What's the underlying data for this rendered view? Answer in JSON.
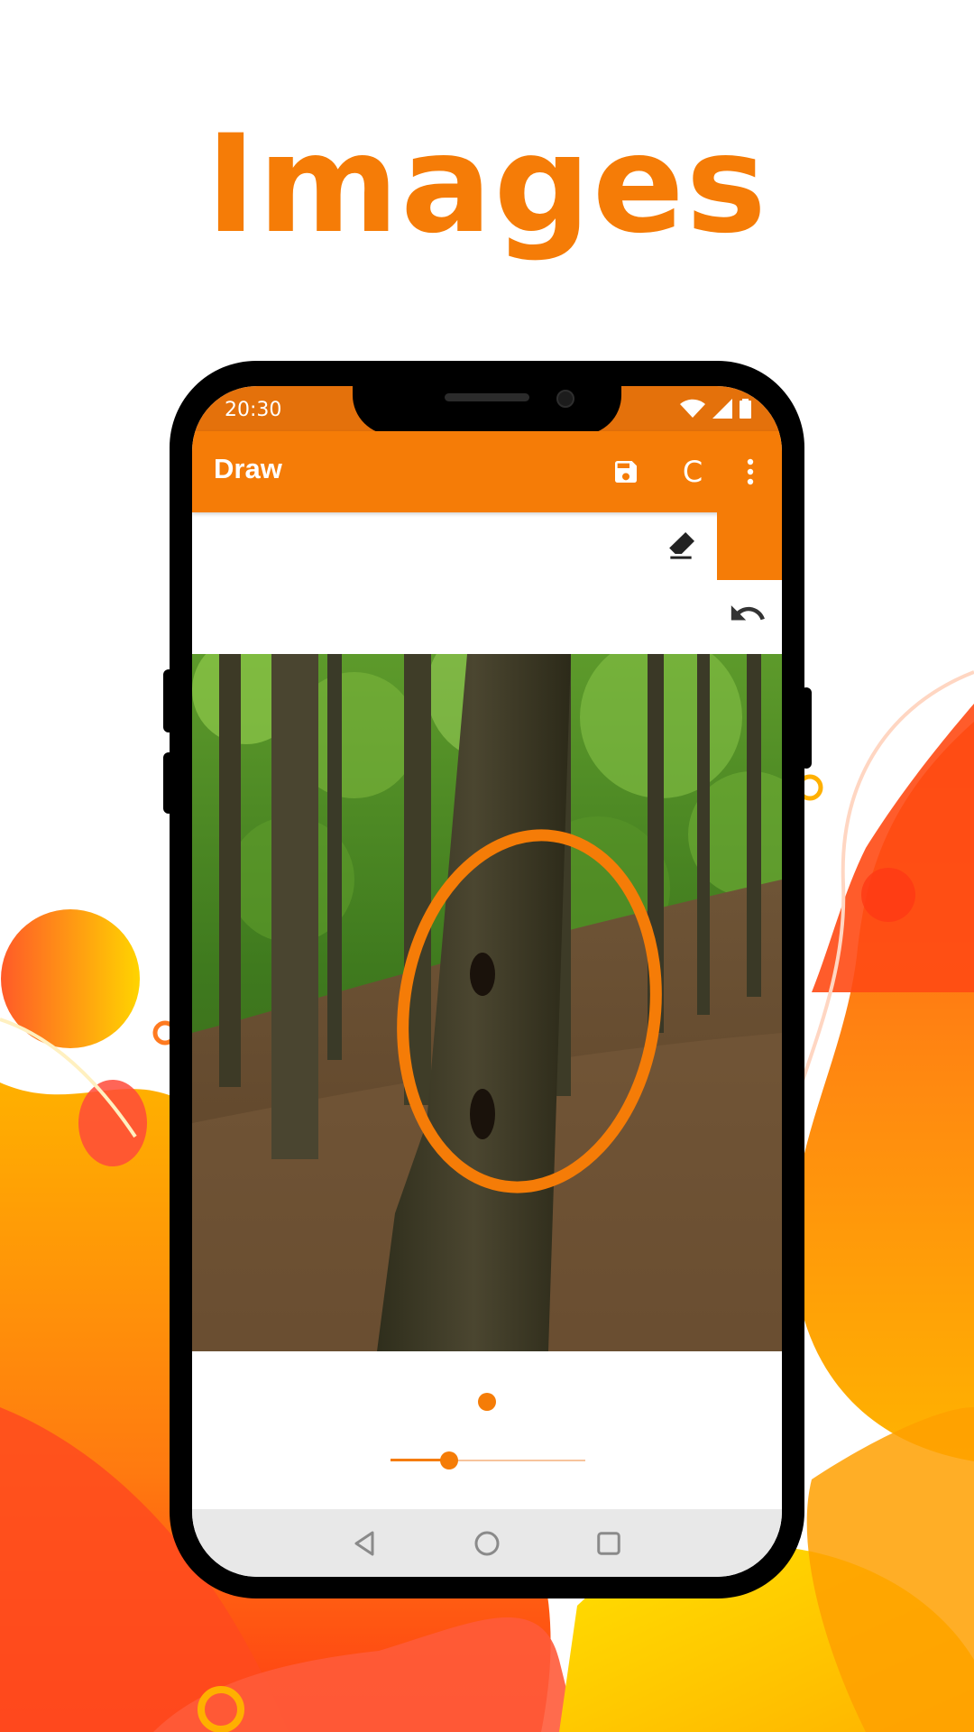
{
  "headline": "Images",
  "status_bar": {
    "time": "20:30",
    "icons": [
      "wifi-icon",
      "signal-icon",
      "battery-icon"
    ]
  },
  "app_bar": {
    "title": "Draw",
    "actions": [
      "save-icon",
      "C",
      "more-vert-icon"
    ],
    "clear_label": "C"
  },
  "tools": {
    "eraser": "eraser-icon",
    "undo": "undo-icon",
    "selected_color": "#f57c07"
  },
  "brush_size": {
    "level": 0.3
  },
  "nav_bar": [
    "back-icon",
    "home-icon",
    "recents-icon"
  ],
  "colors": {
    "accent": "#f57c07",
    "status_bar": "#e4710b",
    "nav_bar": "#e8e8e8",
    "background_shapes": [
      "#ff9a00",
      "#ff5a1f",
      "#ffd200",
      "#ff3d3d"
    ]
  }
}
